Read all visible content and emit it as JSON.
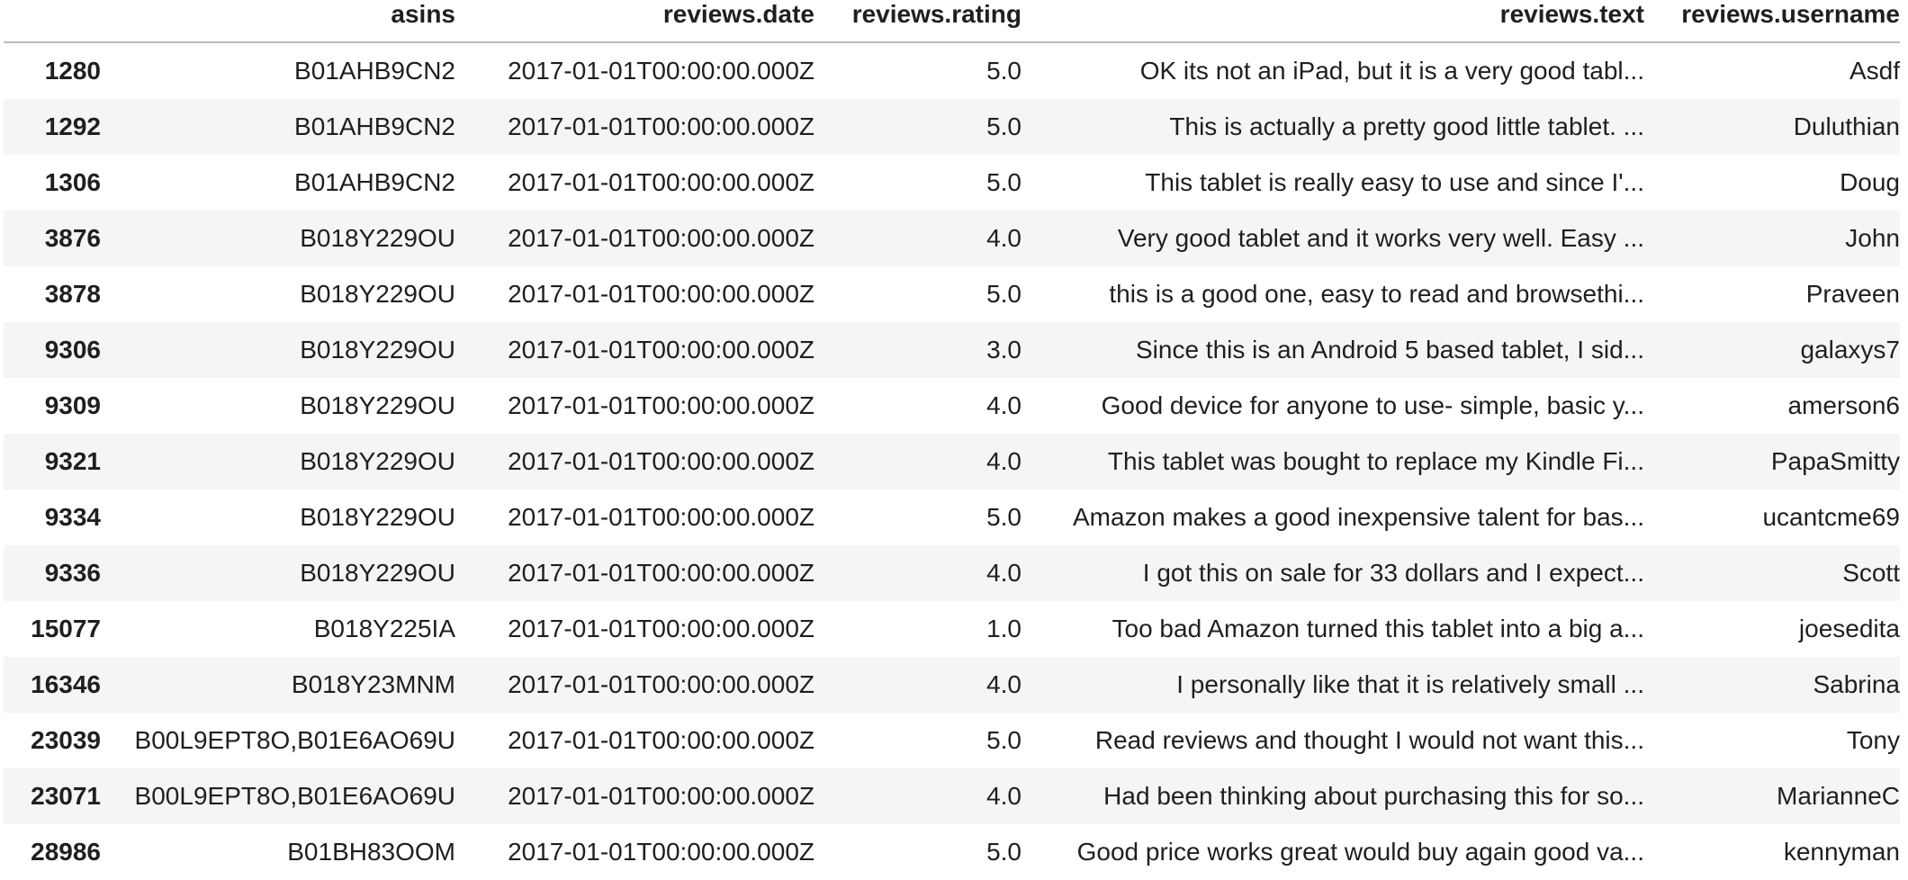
{
  "table": {
    "columns": [
      "",
      "asins",
      "reviews.date",
      "reviews.rating",
      "reviews.text",
      "reviews.username"
    ],
    "rows": [
      {
        "index": "1280",
        "asins": "B01AHB9CN2",
        "date": "2017-01-01T00:00:00.000Z",
        "rating": "5.0",
        "text": "OK its not an iPad, but it is a very good tabl...",
        "username": "Asdf"
      },
      {
        "index": "1292",
        "asins": "B01AHB9CN2",
        "date": "2017-01-01T00:00:00.000Z",
        "rating": "5.0",
        "text": "This is actually a pretty good little tablet. ...",
        "username": "Duluthian"
      },
      {
        "index": "1306",
        "asins": "B01AHB9CN2",
        "date": "2017-01-01T00:00:00.000Z",
        "rating": "5.0",
        "text": "This tablet is really easy to use and since I'...",
        "username": "Doug"
      },
      {
        "index": "3876",
        "asins": "B018Y229OU",
        "date": "2017-01-01T00:00:00.000Z",
        "rating": "4.0",
        "text": "Very good tablet and it works very well. Easy ...",
        "username": "John"
      },
      {
        "index": "3878",
        "asins": "B018Y229OU",
        "date": "2017-01-01T00:00:00.000Z",
        "rating": "5.0",
        "text": "this is a good one, easy to read and browsethi...",
        "username": "Praveen"
      },
      {
        "index": "9306",
        "asins": "B018Y229OU",
        "date": "2017-01-01T00:00:00.000Z",
        "rating": "3.0",
        "text": "Since this is an Android 5 based tablet, I sid...",
        "username": "galaxys7"
      },
      {
        "index": "9309",
        "asins": "B018Y229OU",
        "date": "2017-01-01T00:00:00.000Z",
        "rating": "4.0",
        "text": "Good device for anyone to use- simple, basic y...",
        "username": "amerson6"
      },
      {
        "index": "9321",
        "asins": "B018Y229OU",
        "date": "2017-01-01T00:00:00.000Z",
        "rating": "4.0",
        "text": "This tablet was bought to replace my Kindle Fi...",
        "username": "PapaSmitty"
      },
      {
        "index": "9334",
        "asins": "B018Y229OU",
        "date": "2017-01-01T00:00:00.000Z",
        "rating": "5.0",
        "text": "Amazon makes a good inexpensive talent for bas...",
        "username": "ucantcme69"
      },
      {
        "index": "9336",
        "asins": "B018Y229OU",
        "date": "2017-01-01T00:00:00.000Z",
        "rating": "4.0",
        "text": "I got this on sale for 33 dollars and I expect...",
        "username": "Scott"
      },
      {
        "index": "15077",
        "asins": "B018Y225IA",
        "date": "2017-01-01T00:00:00.000Z",
        "rating": "1.0",
        "text": "Too bad Amazon turned this tablet into a big a...",
        "username": "joesedita"
      },
      {
        "index": "16346",
        "asins": "B018Y23MNM",
        "date": "2017-01-01T00:00:00.000Z",
        "rating": "4.0",
        "text": "I personally like that it is relatively small ...",
        "username": "Sabrina"
      },
      {
        "index": "23039",
        "asins": "B00L9EPT8O,B01E6AO69U",
        "date": "2017-01-01T00:00:00.000Z",
        "rating": "5.0",
        "text": "Read reviews and thought I would not want this...",
        "username": "Tony"
      },
      {
        "index": "23071",
        "asins": "B00L9EPT8O,B01E6AO69U",
        "date": "2017-01-01T00:00:00.000Z",
        "rating": "4.0",
        "text": "Had been thinking about purchasing this for so...",
        "username": "MarianneC"
      },
      {
        "index": "28986",
        "asins": "B01BH83OOM",
        "date": "2017-01-01T00:00:00.000Z",
        "rating": "5.0",
        "text": "Good price works great would buy again good va...",
        "username": "kennyman"
      }
    ]
  }
}
